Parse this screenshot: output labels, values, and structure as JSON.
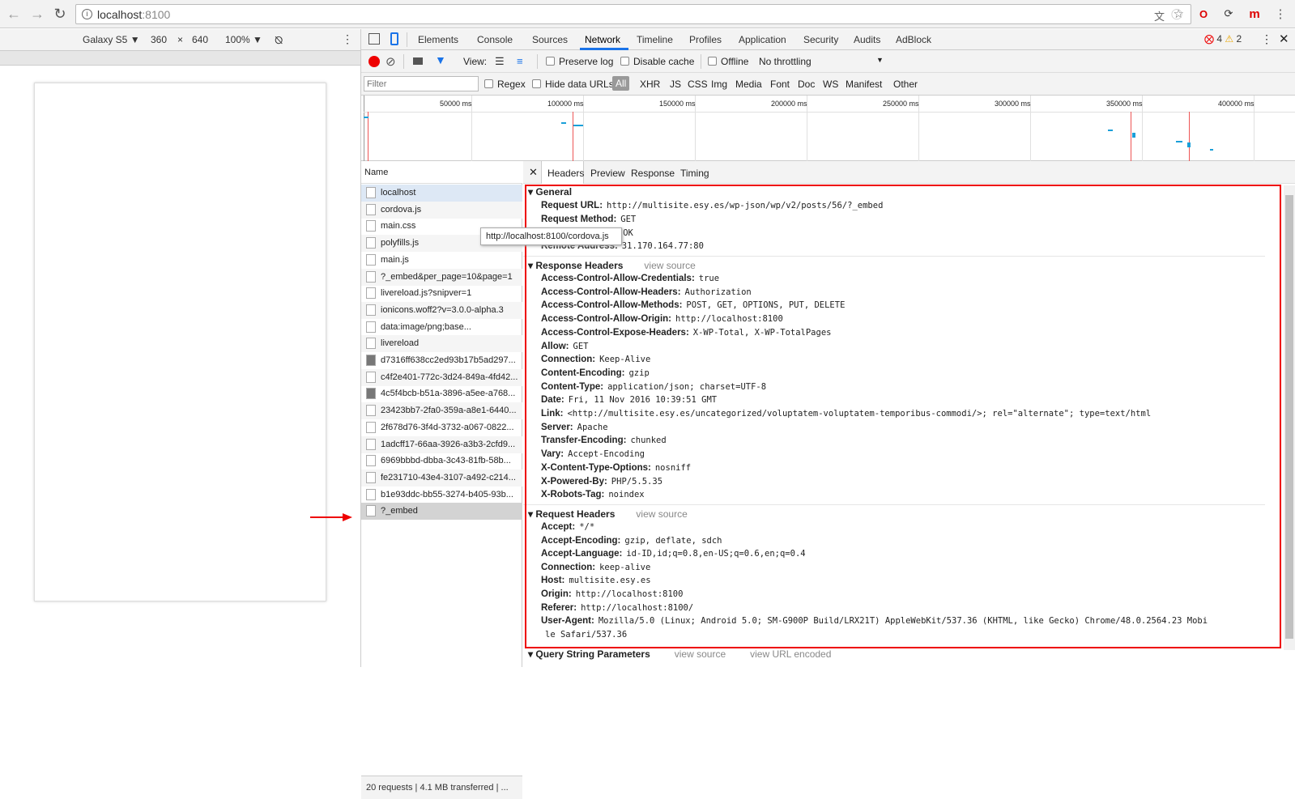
{
  "browser": {
    "url_host": "localhost",
    "url_port": ":8100"
  },
  "device_toolbar": {
    "device": "Galaxy S5 ▼",
    "width": "360",
    "times": "×",
    "height": "640",
    "zoom": "100% ▼"
  },
  "devtools": {
    "tabs": [
      "Elements",
      "Console",
      "Sources",
      "Network",
      "Timeline",
      "Profiles",
      "Application",
      "Security",
      "Audits",
      "AdBlock"
    ],
    "errors": "4",
    "warnings": "2",
    "controls": {
      "view_label": "View:",
      "preserve_log": "Preserve log",
      "disable_cache": "Disable cache",
      "offline": "Offline",
      "throttling": "No throttling"
    },
    "filter": {
      "placeholder": "Filter",
      "regex": "Regex",
      "hide_data_urls": "Hide data URLs",
      "types": [
        "All",
        "XHR",
        "JS",
        "CSS",
        "Img",
        "Media",
        "Font",
        "Doc",
        "WS",
        "Manifest",
        "Other"
      ]
    },
    "timeline_ticks": [
      "50000 ms",
      "100000 ms",
      "150000 ms",
      "200000 ms",
      "250000 ms",
      "300000 ms",
      "350000 ms",
      "400000 ms"
    ],
    "name_header": "Name",
    "requests": [
      {
        "name": "localhost",
        "type": "doc"
      },
      {
        "name": "cordova.js",
        "type": "doc"
      },
      {
        "name": "main.css",
        "type": "doc"
      },
      {
        "name": "polyfills.js",
        "type": "doc"
      },
      {
        "name": "main.js",
        "type": "doc"
      },
      {
        "name": "?_embed&per_page=10&page=1",
        "type": "doc"
      },
      {
        "name": "livereload.js?snipver=1",
        "type": "doc"
      },
      {
        "name": "ionicons.woff2?v=3.0.0-alpha.3",
        "type": "doc"
      },
      {
        "name": "data:image/png;base...",
        "type": "doc"
      },
      {
        "name": "livereload",
        "type": "doc"
      },
      {
        "name": "d7316ff638cc2ed93b17b5ad297...",
        "type": "img"
      },
      {
        "name": "c4f2e401-772c-3d24-849a-4fd42...",
        "type": "doc"
      },
      {
        "name": "4c5f4bcb-b51a-3896-a5ee-a768...",
        "type": "img"
      },
      {
        "name": "23423bb7-2fa0-359a-a8e1-6440...",
        "type": "doc"
      },
      {
        "name": "2f678d76-3f4d-3732-a067-0822...",
        "type": "doc"
      },
      {
        "name": "1adcff17-66aa-3926-a3b3-2cfd9...",
        "type": "doc"
      },
      {
        "name": "6969bbbd-dbba-3c43-81fb-58b...",
        "type": "doc"
      },
      {
        "name": "fe231710-43e4-3107-a492-c214...",
        "type": "doc"
      },
      {
        "name": "b1e93ddc-bb55-3274-b405-93b...",
        "type": "doc"
      },
      {
        "name": "?_embed",
        "type": "doc"
      }
    ],
    "status": "20 requests  |  4.1 MB transferred  |  ...",
    "tooltip": "http://localhost:8100/cordova.js",
    "detail_tabs": [
      "Headers",
      "Preview",
      "Response",
      "Timing"
    ],
    "general_title": "General",
    "general": [
      {
        "k": "Request URL:",
        "v": "http://multisite.esy.es/wp-json/wp/v2/posts/56/?_embed"
      },
      {
        "k": "Request Method:",
        "v": "GET"
      },
      {
        "k": "Status Code:",
        "v": "200 OK"
      },
      {
        "k": "Remote Address:",
        "v": "31.170.164.77:80"
      }
    ],
    "response_title": "Response Headers",
    "view_source": "view source",
    "response": [
      {
        "k": "Access-Control-Allow-Credentials:",
        "v": "true"
      },
      {
        "k": "Access-Control-Allow-Headers:",
        "v": "Authorization"
      },
      {
        "k": "Access-Control-Allow-Methods:",
        "v": "POST, GET, OPTIONS, PUT, DELETE"
      },
      {
        "k": "Access-Control-Allow-Origin:",
        "v": "http://localhost:8100"
      },
      {
        "k": "Access-Control-Expose-Headers:",
        "v": "X-WP-Total, X-WP-TotalPages"
      },
      {
        "k": "Allow:",
        "v": "GET"
      },
      {
        "k": "Connection:",
        "v": "Keep-Alive"
      },
      {
        "k": "Content-Encoding:",
        "v": "gzip"
      },
      {
        "k": "Content-Type:",
        "v": "application/json; charset=UTF-8"
      },
      {
        "k": "Date:",
        "v": "Fri, 11 Nov 2016 10:39:51 GMT"
      },
      {
        "k": "Link:",
        "v": "<http://multisite.esy.es/uncategorized/voluptatem-voluptatem-temporibus-commodi/>; rel=\"alternate\"; type=text/html"
      },
      {
        "k": "Server:",
        "v": "Apache"
      },
      {
        "k": "Transfer-Encoding:",
        "v": "chunked"
      },
      {
        "k": "Vary:",
        "v": "Accept-Encoding"
      },
      {
        "k": "X-Content-Type-Options:",
        "v": "nosniff"
      },
      {
        "k": "X-Powered-By:",
        "v": "PHP/5.5.35"
      },
      {
        "k": "X-Robots-Tag:",
        "v": "noindex"
      }
    ],
    "request_title": "Request Headers",
    "request": [
      {
        "k": "Accept:",
        "v": "*/*"
      },
      {
        "k": "Accept-Encoding:",
        "v": "gzip, deflate, sdch"
      },
      {
        "k": "Accept-Language:",
        "v": "id-ID,id;q=0.8,en-US;q=0.6,en;q=0.4"
      },
      {
        "k": "Connection:",
        "v": "keep-alive"
      },
      {
        "k": "Host:",
        "v": "multisite.esy.es"
      },
      {
        "k": "Origin:",
        "v": "http://localhost:8100"
      },
      {
        "k": "Referer:",
        "v": "http://localhost:8100/"
      },
      {
        "k": "User-Agent:",
        "v": "Mozilla/5.0 (Linux; Android 5.0; SM-G900P Build/LRX21T) AppleWebKit/537.36 (KHTML, like Gecko) Chrome/48.0.2564.23 Mobi"
      },
      {
        "k": "",
        "v": "le Safari/537.36"
      }
    ],
    "query_title": "Query String Parameters",
    "view_url_encoded": "view URL encoded"
  },
  "colors": {
    "accent": "#1a73e8",
    "highlight": "#e00",
    "record": "#e00"
  }
}
